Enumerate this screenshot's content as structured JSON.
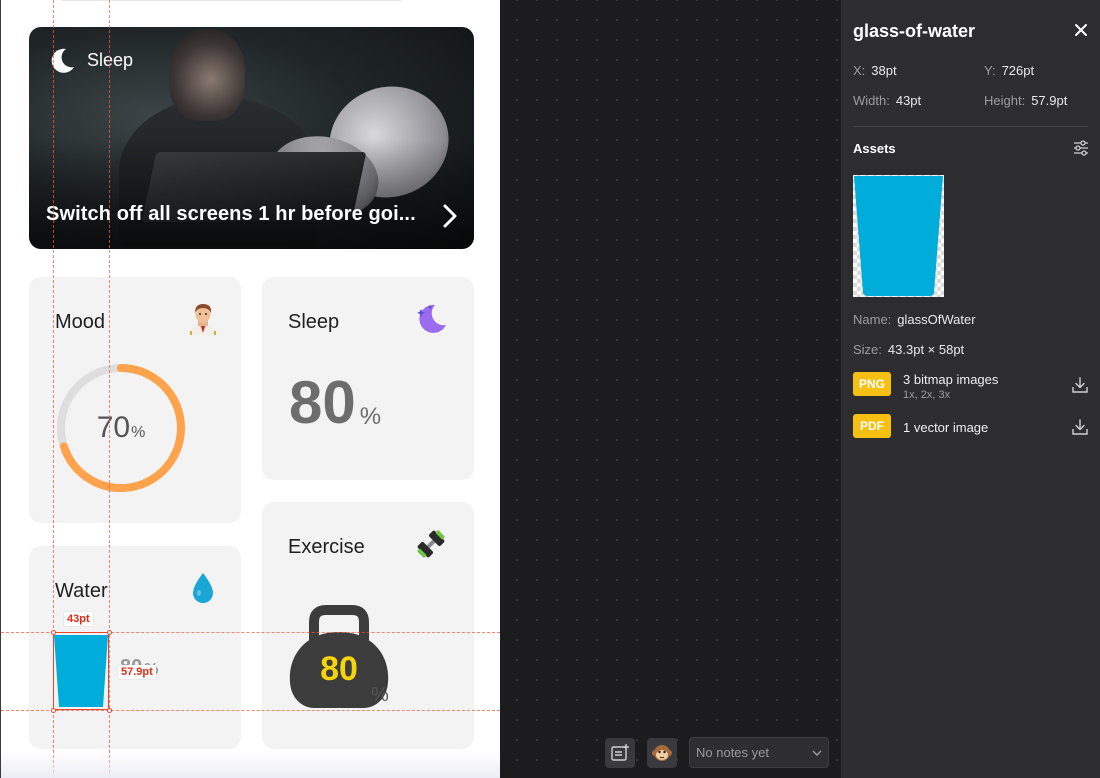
{
  "artboard": {
    "hero": {
      "tag": "Sleep",
      "headline": "Switch off all screens 1 hr before goi..."
    },
    "mood": {
      "title": "Mood",
      "value": "70",
      "unit": "%",
      "progress": 0.7
    },
    "sleep": {
      "title": "Sleep",
      "value": "80",
      "unit": "%"
    },
    "water": {
      "title": "Water",
      "value": "80",
      "unit": "%"
    },
    "exercise": {
      "title": "Exercise",
      "value": "80",
      "unit": "%"
    },
    "measure": {
      "width_label": "43pt",
      "height_label": "57.9pt"
    }
  },
  "canvas": {
    "notes_placeholder": "No notes yet"
  },
  "inspector": {
    "layer_name": "glass-of-water",
    "x_label": "X:",
    "x_value": "38pt",
    "y_label": "Y:",
    "y_value": "726pt",
    "width_label": "Width:",
    "width_value": "43pt",
    "height_label": "Height:",
    "height_value": "57.9pt",
    "assets_title": "Assets",
    "asset_name_label": "Name:",
    "asset_name_value": "glassOfWater",
    "asset_size_label": "Size:",
    "asset_size_value": "43.3pt × 58pt",
    "exports": [
      {
        "badge": "PNG",
        "title": "3 bitmap images",
        "subtitle": "1x, 2x, 3x"
      },
      {
        "badge": "PDF",
        "title": "1 vector image",
        "subtitle": ""
      }
    ]
  },
  "colors": {
    "mood_ring": "#ffa24c",
    "water": "#00acd9",
    "badge": "#f6c012",
    "guide": "#e8442c"
  }
}
